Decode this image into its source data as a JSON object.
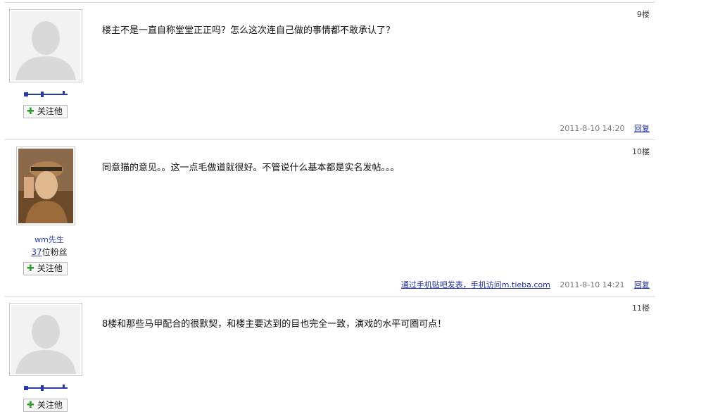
{
  "posts": [
    {
      "floor": "9楼",
      "content": "楼主不是一直自称堂堂正正吗？怎么这次连自己做的事情都不敢承认了？",
      "follow_label": "关注他",
      "time": "2011-8-10 14:20",
      "reply_label": "回复"
    },
    {
      "floor": "10楼",
      "username": "wm先生",
      "fans_count": "37",
      "fans_label": "位粉丝",
      "content": "同意猫的意见。。这一点毛做道就很好。不管说什么基本都是实名发帖。。。",
      "follow_label": "关注他",
      "mobile_link": "通过手机贴吧发表，手机访问m.tieba.com",
      "time": "2011-8-10 14:21",
      "reply_label": "回复"
    },
    {
      "floor": "11楼",
      "content": "8楼和那些马甲配合的很默契，和楼主要达到的目也完全一致，演戏的水平可圈可点！",
      "follow_label": "关注他"
    }
  ],
  "colors": {
    "link": "#223399",
    "border": "#dcdcdc",
    "plus": "#2a9a2a"
  }
}
